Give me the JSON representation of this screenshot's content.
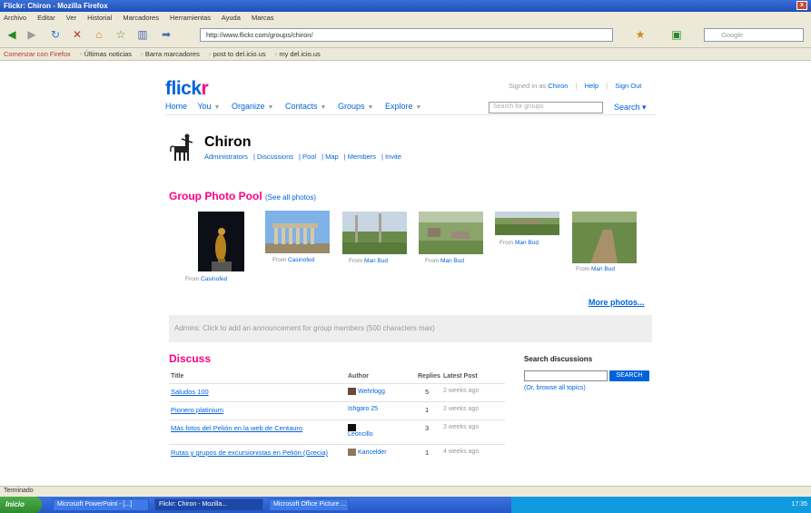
{
  "window": {
    "title": "Flickr: Chiron - Mozilla Firefox",
    "close": "x"
  },
  "menu": [
    "Archivo",
    "Editar",
    "Ver",
    "Historial",
    "Marcadores",
    "Herramientas",
    "Ayuda",
    "Marcas"
  ],
  "address": {
    "url": "http://www.flickr.com/groups/chiron/",
    "search_placeholder": "Google"
  },
  "bookmarks": [
    "Comenzar con Firefox",
    "Últimas noticias",
    "Barra marcadores",
    "post to del.icio.us",
    "my del.icio.us"
  ],
  "flickr": {
    "logo_a": "flick",
    "logo_b": "r",
    "signed_in": "Signed in as",
    "user": "Chiron",
    "help": "Help",
    "signout": "Sign Out",
    "nav": [
      "Home",
      "You",
      "Organize",
      "Contacts",
      "Groups",
      "Explore"
    ],
    "search_placeholder": "Search for groups",
    "search_label": "Search"
  },
  "group": {
    "name": "Chiron",
    "links": [
      "Administrators",
      "Discussions",
      "Pool",
      "Map",
      "Members",
      "Invite"
    ]
  },
  "pool": {
    "title": "Group Photo Pool",
    "see_all": "(See all photos)",
    "more": "More photos...",
    "photos": [
      {
        "caption": "From",
        "author": "Casinofed",
        "scene": "statue"
      },
      {
        "caption": "From",
        "author": "Casinofed",
        "scene": "temple"
      },
      {
        "caption": "From",
        "author": "Man Bud",
        "scene": "field"
      },
      {
        "caption": "From",
        "author": "Man Bud",
        "scene": "ruins"
      },
      {
        "caption": "From",
        "author": "Man Bud",
        "scene": "field2"
      },
      {
        "caption": "From",
        "author": "Man Bud",
        "scene": "path"
      }
    ]
  },
  "addbar": {
    "text": "Admins: Click to add an announcement for group members (500 characters max)"
  },
  "discuss": {
    "title": "Discuss",
    "headers": {
      "title": "Title",
      "author": "Author",
      "replies": "Replies",
      "latest": "Latest Post"
    },
    "rows": [
      {
        "title": "Saludos 100",
        "author": "Wehrlogg",
        "replies": "5",
        "latest": "2 weeks ago"
      },
      {
        "title": "Pionero platinium",
        "author": "Ishgaro 25",
        "replies": "1",
        "latest": "2 weeks ago"
      },
      {
        "title": "Más fotos del Pelión en la web de Centauro",
        "author": "Leoncillo",
        "replies": "3",
        "latest": "3 weeks ago"
      },
      {
        "title": "Rutas y grupos de excursionistas en Pelión (Grecia)",
        "author": "Kancelder",
        "replies": "1",
        "latest": "4 weeks ago"
      }
    ]
  },
  "search_discussions": {
    "title": "Search discussions",
    "button": "SEARCH",
    "link": "(Or, browse all topics)"
  },
  "status": "Terminado",
  "taskbar": {
    "start": "Inicio",
    "tasks": [
      "Microsoft PowerPoint - [...]",
      "Flickr: Chiron - Mozilla...",
      "Microsoft Office Picture ..."
    ],
    "clock": "17:35"
  }
}
